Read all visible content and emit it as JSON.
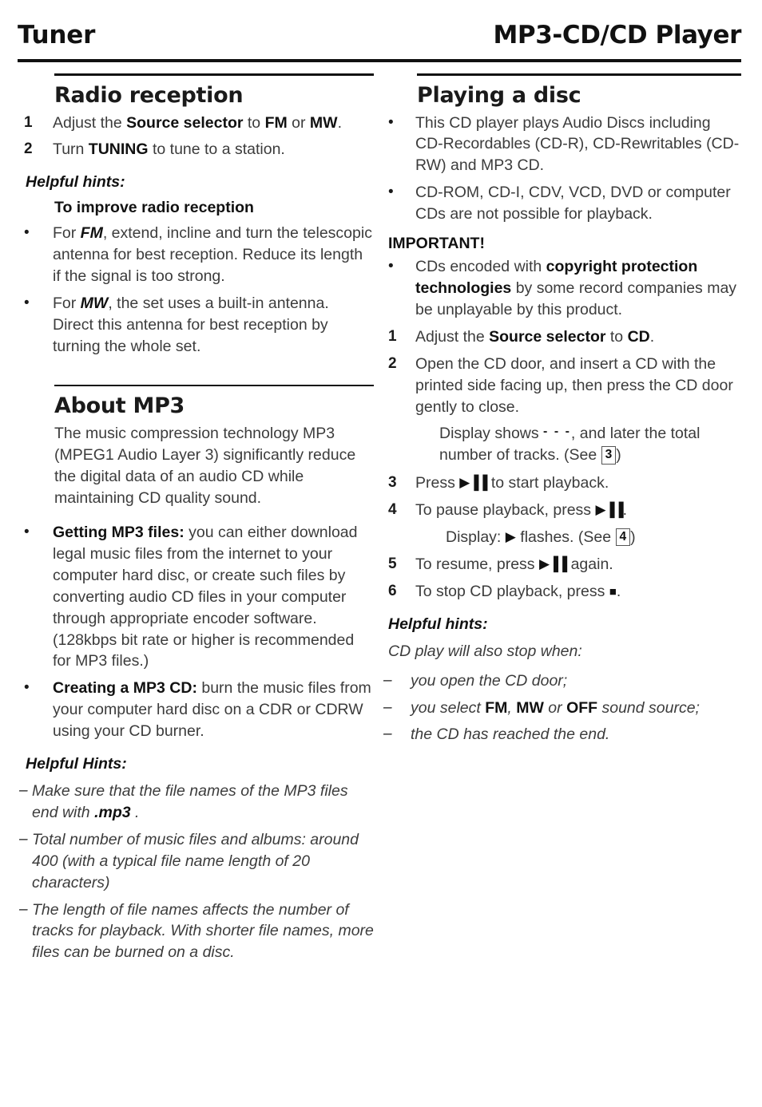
{
  "header": {
    "left_title": "Tuner",
    "right_title": "MP3-CD/CD Player"
  },
  "left_column": {
    "radio_reception": {
      "title": "Radio reception",
      "steps": [
        {
          "num": "1",
          "text_parts": [
            "Adjust the ",
            "Source selector",
            " to ",
            "FM",
            " or ",
            "MW",
            "."
          ]
        },
        {
          "num": "2",
          "text_parts": [
            "Turn ",
            "TUNING",
            " to tune to a station."
          ]
        }
      ],
      "hints_label": "Helpful hints:",
      "hints_subhead": "To improve radio reception",
      "bullets": [
        {
          "marker": "•",
          "lead": "For ",
          "em": "FM",
          "rest": ", extend, incline and turn the telescopic antenna for best reception. Reduce its length if the signal is too strong."
        },
        {
          "marker": "•",
          "lead": "For ",
          "em": "MW",
          "rest": ", the set uses a built-in antenna. Direct this antenna for best reception by turning the whole set."
        }
      ]
    },
    "about_mp3": {
      "title": "About MP3",
      "intro": "The music compression technology MP3 (MPEG1 Audio Layer 3) significantly reduce the digital data of an audio CD while maintaining CD quality sound.",
      "bullets": [
        {
          "marker": "•",
          "bold": "Getting MP3 files:",
          "rest": " you can either download legal music files from the internet to your computer hard disc, or create such files by converting audio CD files in your computer through appropriate encoder software. (128kbps bit rate or higher is recommended for MP3 files.)"
        },
        {
          "marker": "•",
          "bold": "Creating a MP3 CD:",
          "rest": " burn the music files from your computer hard disc on a CDR or CDRW using your CD burner."
        }
      ],
      "hints_label": "Helpful Hints:",
      "hints": [
        {
          "marker": "–",
          "lead": "Make sure that the file names of the MP3 files end with ",
          "bold": ".mp3",
          "rest": " ."
        },
        {
          "marker": "–",
          "lead": "Total number of music files and albums: around 400 (with a typical file name length of 20 characters)",
          "bold": "",
          "rest": ""
        },
        {
          "marker": "–",
          "lead": "The length of file names affects the number of tracks for playback. With shorter file names, more files can be burned on a disc.",
          "bold": "",
          "rest": ""
        }
      ]
    }
  },
  "right_column": {
    "playing_a_disc": {
      "title": "Playing a disc",
      "bullets": [
        {
          "marker": "•",
          "text": "This CD player plays Audio Discs including CD-Recordables (CD-R), CD-Rewritables (CD-RW) and MP3 CD."
        },
        {
          "marker": "•",
          "text": "CD-ROM, CD-I, CDV, VCD, DVD or computer CDs are not possible for playback."
        }
      ],
      "important_label": "IMPORTANT!",
      "important_bullet": {
        "marker": "•",
        "lead": "CDs encoded with ",
        "bold": "copyright protection technologies",
        "rest": " by some record companies may be unplayable by this product."
      },
      "steps": [
        {
          "num": "1",
          "lead": "Adjust the ",
          "bold1": "Source selector",
          "mid": " to ",
          "bold2": "CD",
          "tail": "."
        },
        {
          "num": "2",
          "lead": "Open the CD door, and insert a CD with the printed side facing up, then press the CD door gently to close."
        },
        {
          "num": "3",
          "lead": "Press ",
          "glyph": "play-pause-icon",
          "tail": " to start playback."
        },
        {
          "num": "4",
          "lead": "To pause playback, press ",
          "glyph": "play-pause-icon",
          "tail": "."
        },
        {
          "num": "5",
          "lead": "To resume, press ",
          "glyph": "play-pause-icon",
          "tail": " again."
        },
        {
          "num": "6",
          "lead": "To stop CD playback, press ",
          "glyph": "stop-icon",
          "tail": "."
        }
      ],
      "display_note_1": {
        "lead": "Display shows ",
        "dashes": "- - -",
        "mid": ", and later the total number of tracks. (See ",
        "boxnum": "3",
        "tail": ")"
      },
      "display_note_2": {
        "lead": "Display: ",
        "glyph": "play-icon",
        "mid": " flashes. (See ",
        "boxnum": "4",
        "tail": ")"
      },
      "hints_label": "Helpful hints:",
      "hints_intro": "CD play will also stop when:",
      "hints": [
        {
          "marker": "–",
          "text": "you open the CD door;"
        },
        {
          "marker": "–",
          "lead": "you select ",
          "b1": "FM",
          "s1": ", ",
          "b2": "MW",
          "s2": " or ",
          "b3": "OFF",
          "tail": " sound source;"
        },
        {
          "marker": "–",
          "text": "the CD has reached the end."
        }
      ]
    }
  },
  "glyphs": {
    "play_pause": "▶▐▐",
    "play": "▶",
    "stop": "■"
  }
}
